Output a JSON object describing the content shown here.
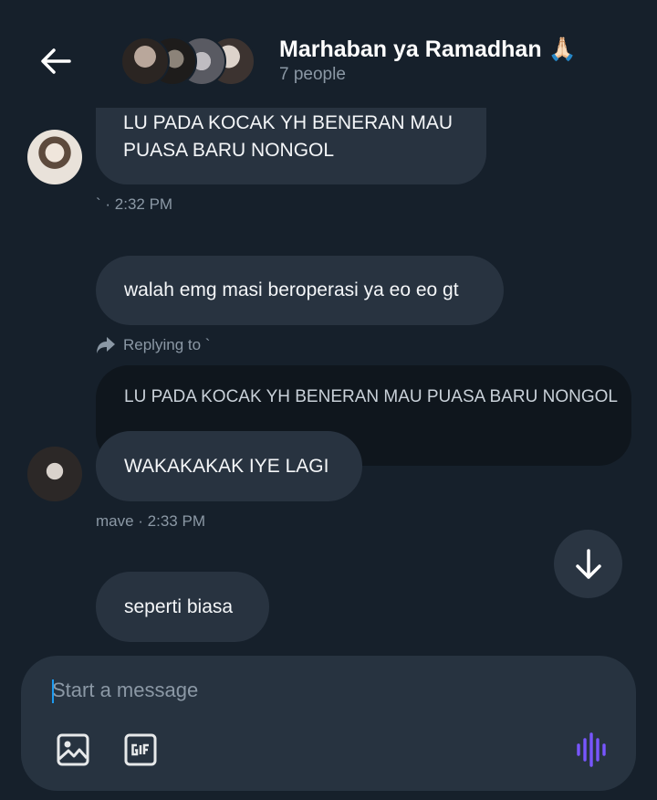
{
  "header": {
    "title": "Marhaban ya Ramadhan 🙏🏻",
    "subtitle": "7 people",
    "back_icon": "arrow-left-icon"
  },
  "messages": [
    {
      "text": "LU PADA KOCAK YH BENERAN MAU PUASA BARU NONGOL",
      "meta": "` · 2:32 PM"
    },
    {
      "text": "walah emg masi beroperasi ya eo eo gt"
    },
    {
      "reply_label": "Replying to `",
      "quote": "LU PADA KOCAK YH BENERAN MAU PUASA BARU NONGOL",
      "text": "WAKAKAKAK IYE LAGI",
      "meta": "mave · 2:33 PM"
    },
    {
      "text": "seperti biasa"
    }
  ],
  "composer": {
    "placeholder": "Start a message",
    "value": "",
    "icons": [
      "image-icon",
      "gif-icon",
      "voice-icon"
    ]
  },
  "colors": {
    "background": "#16202b",
    "bubble": "#283340",
    "quote_bubble": "#0f161d",
    "accent_voice": "#7856ff",
    "muted_text": "#8b98a5"
  }
}
